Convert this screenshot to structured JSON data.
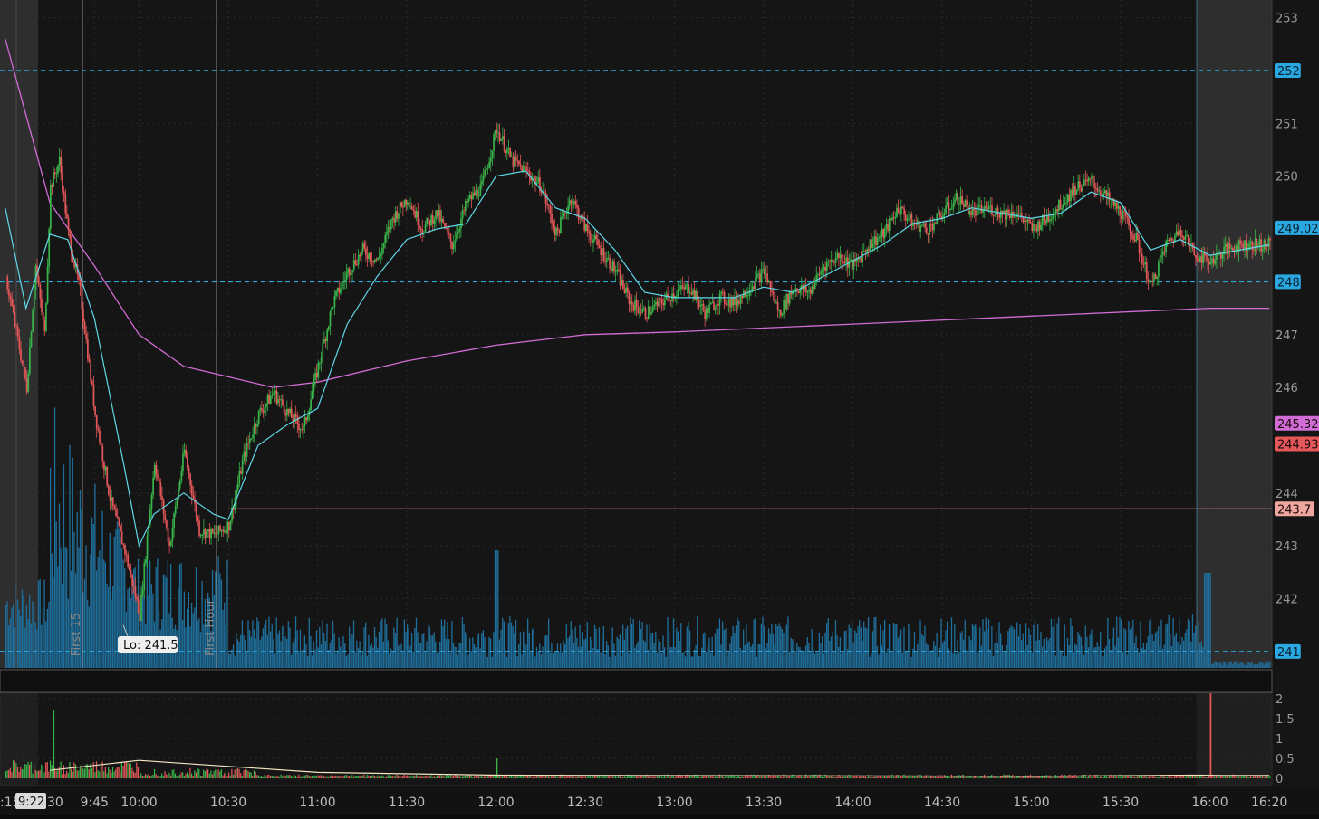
{
  "colors": {
    "background": "#181818",
    "ext_hours_shade": "#2e2e2e",
    "grid": "#2a2a2a",
    "up": "#39b54a",
    "down": "#e5585a",
    "volume": "#1f6f9c",
    "ema": "#5fd7e8",
    "vwap": "#d26cd6",
    "level_line": "#2aa8e0",
    "prior_close": "#f0a6a0",
    "rel_vol_line": "#f2e6c2"
  },
  "labels": {
    "lo_label": "Lo: 241.5",
    "time_cursor": "9:22",
    "first15": "First 15",
    "first_hour": "First Hour",
    "left_edge": ":15",
    "left_edge_suffix": "30"
  },
  "chart_data": [
    {
      "type": "line",
      "subtype": "candlestick-intraday",
      "y_ticks": [
        "253",
        "252",
        "251",
        "250",
        "249.02",
        "248",
        "247",
        "246",
        "245.32",
        "244.93",
        "244",
        "243.7",
        "243",
        "242",
        "241"
      ],
      "x_ticks": [
        "9:45",
        "10:00",
        "10:30",
        "11:00",
        "11:30",
        "12:00",
        "12:30",
        "13:00",
        "13:30",
        "14:00",
        "14:30",
        "15:00",
        "15:30",
        "16:00",
        "16:20"
      ],
      "ylim": [
        240.7,
        253.4
      ],
      "grid": true,
      "price_tags": [
        {
          "value": 252,
          "label": "252",
          "color": "#2aa8e0",
          "style": "level"
        },
        {
          "value": 249.02,
          "label": "249.02",
          "color": "#2aa8e0",
          "style": "last"
        },
        {
          "value": 248,
          "label": "248",
          "color": "#2aa8e0",
          "style": "level"
        },
        {
          "value": 245.32,
          "label": "245.32",
          "color": "#d26cd6",
          "style": "vwap"
        },
        {
          "value": 244.93,
          "label": "244.93",
          "color": "#e5585a",
          "style": "close"
        },
        {
          "value": 243.7,
          "label": "243.7",
          "color": "#f0a6a0",
          "style": "prior"
        },
        {
          "value": 241,
          "label": "241",
          "color": "#2aa8e0",
          "style": "level"
        }
      ],
      "axis_numbers": [
        253,
        251,
        250,
        247,
        246,
        244,
        243,
        242
      ],
      "low_value": 241.5,
      "price_path": [
        [
          "9:15",
          248.1
        ],
        [
          "9:22",
          246.0
        ],
        [
          "9:25",
          248.3
        ],
        [
          "9:28",
          247.0
        ],
        [
          "9:30",
          249.8
        ],
        [
          "9:33",
          250.3
        ],
        [
          "9:36",
          248.9
        ],
        [
          "9:40",
          247.8
        ],
        [
          "9:45",
          245.5
        ],
        [
          "9:50",
          243.9
        ],
        [
          "9:55",
          242.9
        ],
        [
          "10:00",
          241.7
        ],
        [
          "10:05",
          244.6
        ],
        [
          "10:10",
          243.0
        ],
        [
          "10:15",
          244.8
        ],
        [
          "10:20",
          243.3
        ],
        [
          "10:25",
          243.2
        ],
        [
          "10:30",
          243.4
        ],
        [
          "10:35",
          244.7
        ],
        [
          "10:40",
          245.5
        ],
        [
          "10:45",
          245.9
        ],
        [
          "10:50",
          245.5
        ],
        [
          "10:55",
          245.2
        ],
        [
          "11:00",
          246.4
        ],
        [
          "11:05",
          247.6
        ],
        [
          "11:10",
          248.2
        ],
        [
          "11:15",
          248.6
        ],
        [
          "11:20",
          248.4
        ],
        [
          "11:25",
          249.2
        ],
        [
          "11:30",
          249.6
        ],
        [
          "11:35",
          249.0
        ],
        [
          "11:40",
          249.3
        ],
        [
          "11:45",
          248.7
        ],
        [
          "11:50",
          249.5
        ],
        [
          "11:55",
          249.8
        ],
        [
          "12:00",
          250.9
        ],
        [
          "12:05",
          250.3
        ],
        [
          "12:10",
          250.1
        ],
        [
          "12:15",
          249.8
        ],
        [
          "12:20",
          248.9
        ],
        [
          "12:25",
          249.6
        ],
        [
          "12:30",
          249.0
        ],
        [
          "12:35",
          248.6
        ],
        [
          "12:40",
          248.2
        ],
        [
          "12:45",
          247.6
        ],
        [
          "12:50",
          247.4
        ],
        [
          "12:55",
          247.6
        ],
        [
          "13:00",
          247.8
        ],
        [
          "13:05",
          247.9
        ],
        [
          "13:10",
          247.4
        ],
        [
          "13:15",
          247.7
        ],
        [
          "13:20",
          247.6
        ],
        [
          "13:25",
          247.9
        ],
        [
          "13:30",
          248.2
        ],
        [
          "13:35",
          247.4
        ],
        [
          "13:40",
          247.9
        ],
        [
          "13:45",
          247.8
        ],
        [
          "13:50",
          248.3
        ],
        [
          "13:55",
          248.5
        ],
        [
          "14:00",
          248.3
        ],
        [
          "14:05",
          248.7
        ],
        [
          "14:10",
          248.9
        ],
        [
          "14:15",
          249.4
        ],
        [
          "14:20",
          249.1
        ],
        [
          "14:25",
          249.0
        ],
        [
          "14:30",
          249.3
        ],
        [
          "14:35",
          249.6
        ],
        [
          "14:40",
          249.3
        ],
        [
          "14:45",
          249.4
        ],
        [
          "14:50",
          249.3
        ],
        [
          "14:55",
          249.3
        ],
        [
          "15:00",
          249.0
        ],
        [
          "15:05",
          249.2
        ],
        [
          "15:10",
          249.5
        ],
        [
          "15:15",
          249.8
        ],
        [
          "15:20",
          249.9
        ],
        [
          "15:25",
          249.6
        ],
        [
          "15:30",
          249.3
        ],
        [
          "15:35",
          248.8
        ],
        [
          "15:40",
          247.9
        ],
        [
          "15:45",
          248.7
        ],
        [
          "15:50",
          249.0
        ],
        [
          "15:55",
          248.5
        ],
        [
          "16:00",
          248.4
        ],
        [
          "16:05",
          248.6
        ],
        [
          "16:10",
          248.7
        ],
        [
          "16:15",
          248.7
        ],
        [
          "16:20",
          248.7
        ]
      ],
      "vwap_path": [
        [
          "9:15",
          252.6
        ],
        [
          "9:30",
          249.5
        ],
        [
          "9:45",
          248.3
        ],
        [
          "10:00",
          247.0
        ],
        [
          "10:15",
          246.4
        ],
        [
          "10:30",
          246.2
        ],
        [
          "10:45",
          246.0
        ],
        [
          "11:00",
          246.1
        ],
        [
          "11:30",
          246.5
        ],
        [
          "12:00",
          246.8
        ],
        [
          "12:30",
          247.0
        ],
        [
          "13:00",
          247.05
        ],
        [
          "14:00",
          247.2
        ],
        [
          "15:00",
          247.35
        ],
        [
          "16:00",
          247.5
        ],
        [
          "16:20",
          247.5
        ]
      ],
      "ema_path": [
        [
          "9:15",
          249.4
        ],
        [
          "9:22",
          247.5
        ],
        [
          "9:30",
          248.9
        ],
        [
          "9:36",
          248.8
        ],
        [
          "9:45",
          247.3
        ],
        [
          "9:55",
          244.5
        ],
        [
          "10:00",
          243.0
        ],
        [
          "10:05",
          243.6
        ],
        [
          "10:15",
          244.0
        ],
        [
          "10:25",
          243.6
        ],
        [
          "10:30",
          243.5
        ],
        [
          "10:40",
          244.9
        ],
        [
          "10:50",
          245.3
        ],
        [
          "11:00",
          245.6
        ],
        [
          "11:10",
          247.2
        ],
        [
          "11:20",
          248.1
        ],
        [
          "11:30",
          248.8
        ],
        [
          "11:40",
          249.0
        ],
        [
          "11:50",
          249.1
        ],
        [
          "12:00",
          250.0
        ],
        [
          "12:10",
          250.1
        ],
        [
          "12:20",
          249.4
        ],
        [
          "12:30",
          249.2
        ],
        [
          "12:40",
          248.6
        ],
        [
          "12:50",
          247.8
        ],
        [
          "13:00",
          247.7
        ],
        [
          "13:20",
          247.7
        ],
        [
          "13:30",
          247.9
        ],
        [
          "13:40",
          247.8
        ],
        [
          "13:50",
          248.1
        ],
        [
          "14:00",
          248.4
        ],
        [
          "14:10",
          248.7
        ],
        [
          "14:20",
          249.1
        ],
        [
          "14:30",
          249.2
        ],
        [
          "14:40",
          249.4
        ],
        [
          "14:50",
          249.3
        ],
        [
          "15:00",
          249.2
        ],
        [
          "15:10",
          249.3
        ],
        [
          "15:20",
          249.7
        ],
        [
          "15:30",
          249.5
        ],
        [
          "15:40",
          248.6
        ],
        [
          "15:50",
          248.8
        ],
        [
          "16:00",
          248.5
        ],
        [
          "16:10",
          248.6
        ],
        [
          "16:20",
          248.7
        ]
      ]
    },
    {
      "type": "bar",
      "title": "",
      "y_ticks": [
        "2",
        "1.5",
        "1",
        "0.5",
        "0"
      ],
      "ylim": [
        0,
        2.5
      ],
      "spikes": [
        {
          "time": "9:31",
          "value": 1.7,
          "color": "up"
        },
        {
          "time": "12:00",
          "value": 0.5,
          "color": "up"
        },
        {
          "time": "16:00",
          "value": 2.6,
          "color": "down"
        }
      ],
      "avg_line": [
        [
          "9:30",
          0.2
        ],
        [
          "10:00",
          0.45
        ],
        [
          "10:30",
          0.3
        ],
        [
          "11:00",
          0.15
        ],
        [
          "12:00",
          0.08
        ],
        [
          "15:00",
          0.05
        ],
        [
          "15:55",
          0.08
        ],
        [
          "16:05",
          0.07
        ],
        [
          "16:20",
          0.07
        ]
      ]
    }
  ]
}
